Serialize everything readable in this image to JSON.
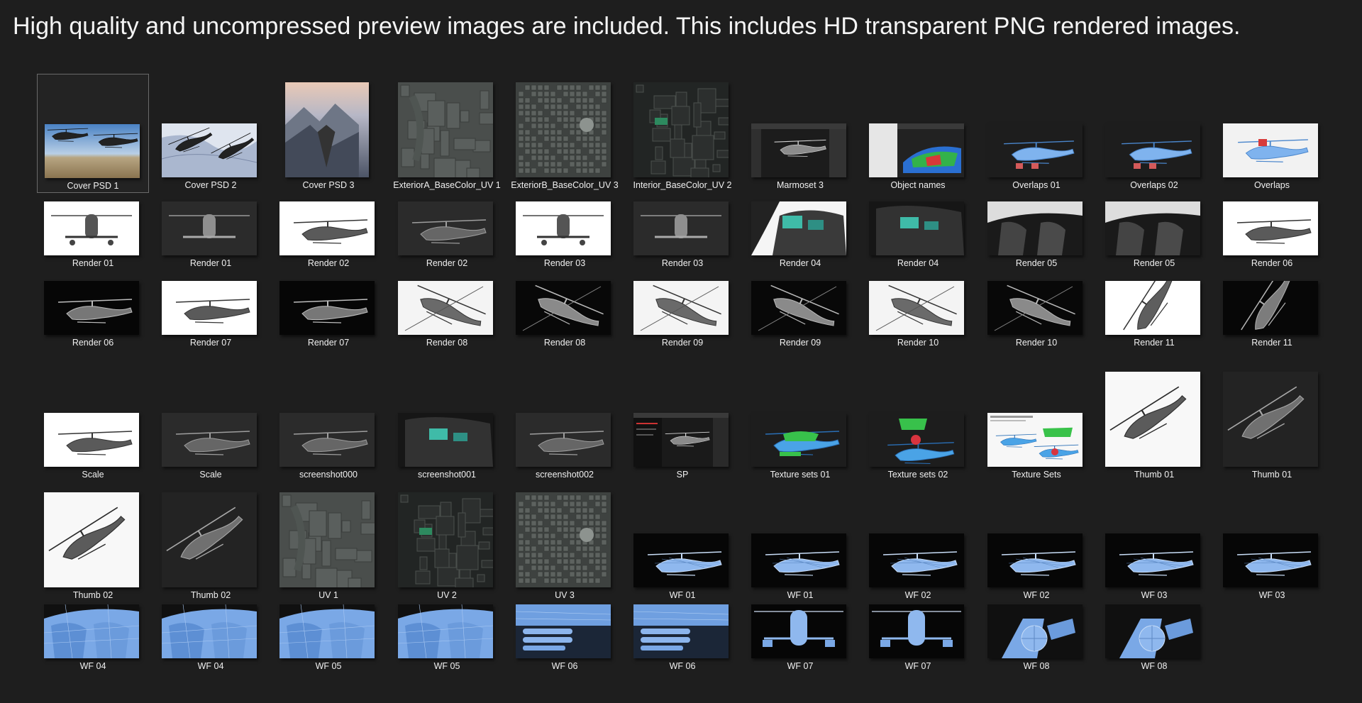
{
  "headline": "High quality and uncompressed preview images are included. This includes HD transparent PNG rendered images.",
  "files": [
    {
      "name": "Cover PSD 1",
      "kind": "sky",
      "selected": true
    },
    {
      "name": "Cover PSD 2",
      "kind": "snow"
    },
    {
      "name": "Cover PSD 3",
      "kind": "mountain"
    },
    {
      "name": "ExteriorA_BaseColor_UV 1",
      "kind": "uv"
    },
    {
      "name": "ExteriorB_BaseColor_UV 3",
      "kind": "uv-detail"
    },
    {
      "name": "Interior_BaseColor_UV 2",
      "kind": "uv-dark"
    },
    {
      "name": "Marmoset 3",
      "kind": "app"
    },
    {
      "name": "Object names",
      "kind": "app-color"
    },
    {
      "name": "Overlaps 01",
      "kind": "blue-dark"
    },
    {
      "name": "Overlaps 02",
      "kind": "blue-dark"
    },
    {
      "name": "Overlaps",
      "kind": "blue-light"
    },
    {
      "name": "Render 01",
      "kind": "white-front"
    },
    {
      "name": "Render 01",
      "kind": "dark-front"
    },
    {
      "name": "Render 02",
      "kind": "white-side"
    },
    {
      "name": "Render 02",
      "kind": "dark-side"
    },
    {
      "name": "Render 03",
      "kind": "white-front"
    },
    {
      "name": "Render 03",
      "kind": "dark-front"
    },
    {
      "name": "Render 04",
      "kind": "white-cockpit"
    },
    {
      "name": "Render 04",
      "kind": "dark-cockpit"
    },
    {
      "name": "Render 05",
      "kind": "seat"
    },
    {
      "name": "Render 05",
      "kind": "seat"
    },
    {
      "name": "Render 06",
      "kind": "white-side"
    },
    {
      "name": "Render 06",
      "kind": "black-side"
    },
    {
      "name": "Render 07",
      "kind": "white-side"
    },
    {
      "name": "Render 07",
      "kind": "black-side"
    },
    {
      "name": "Render 08",
      "kind": "white-under"
    },
    {
      "name": "Render 08",
      "kind": "black-under"
    },
    {
      "name": "Render 09",
      "kind": "white-under"
    },
    {
      "name": "Render 09",
      "kind": "black-under"
    },
    {
      "name": "Render 10",
      "kind": "white-under"
    },
    {
      "name": "Render 10",
      "kind": "black-under"
    },
    {
      "name": "Render 11",
      "kind": "white-tall"
    },
    {
      "name": "Render 11",
      "kind": "black-tall"
    },
    {
      "name": "Scale",
      "kind": "white-side"
    },
    {
      "name": "Scale",
      "kind": "dark-side"
    },
    {
      "name": "screenshot000",
      "kind": "dark-side"
    },
    {
      "name": "screenshot001",
      "kind": "dark-cockpit"
    },
    {
      "name": "screenshot002",
      "kind": "dark-side"
    },
    {
      "name": "SP",
      "kind": "app-dark"
    },
    {
      "name": "Texture sets 01",
      "kind": "texture"
    },
    {
      "name": "Texture sets 02",
      "kind": "texture2"
    },
    {
      "name": "Texture Sets",
      "kind": "texture-light"
    },
    {
      "name": "Thumb 01",
      "kind": "white-big"
    },
    {
      "name": "Thumb 01",
      "kind": "dark-big"
    },
    {
      "name": "Thumb 02",
      "kind": "white-big"
    },
    {
      "name": "Thumb 02",
      "kind": "dark-big"
    },
    {
      "name": "UV 1",
      "kind": "uv"
    },
    {
      "name": "UV 2",
      "kind": "uv-dark"
    },
    {
      "name": "UV 3",
      "kind": "uv-detail"
    },
    {
      "name": "WF 01",
      "kind": "wf"
    },
    {
      "name": "WF 01",
      "kind": "wf"
    },
    {
      "name": "WF 02",
      "kind": "wf"
    },
    {
      "name": "WF 02",
      "kind": "wf"
    },
    {
      "name": "WF 03",
      "kind": "wf"
    },
    {
      "name": "WF 03",
      "kind": "wf"
    },
    {
      "name": "WF 04",
      "kind": "wf-cockpit"
    },
    {
      "name": "WF 04",
      "kind": "wf-cockpit"
    },
    {
      "name": "WF 05",
      "kind": "wf-cockpit"
    },
    {
      "name": "WF 05",
      "kind": "wf-cockpit"
    },
    {
      "name": "WF 06",
      "kind": "wf-weapons"
    },
    {
      "name": "WF 06",
      "kind": "wf-weapons"
    },
    {
      "name": "WF 07",
      "kind": "wf-front"
    },
    {
      "name": "WF 07",
      "kind": "wf-front"
    },
    {
      "name": "WF 08",
      "kind": "wf-tail"
    },
    {
      "name": "WF 08",
      "kind": "wf-tail"
    }
  ],
  "colors": {
    "background": "#1e1e1e",
    "selection_border": "#6a6a6a",
    "wireframe_blue": "#7aa8e6",
    "texture_green": "#39c24a",
    "texture_red": "#d8343f"
  }
}
